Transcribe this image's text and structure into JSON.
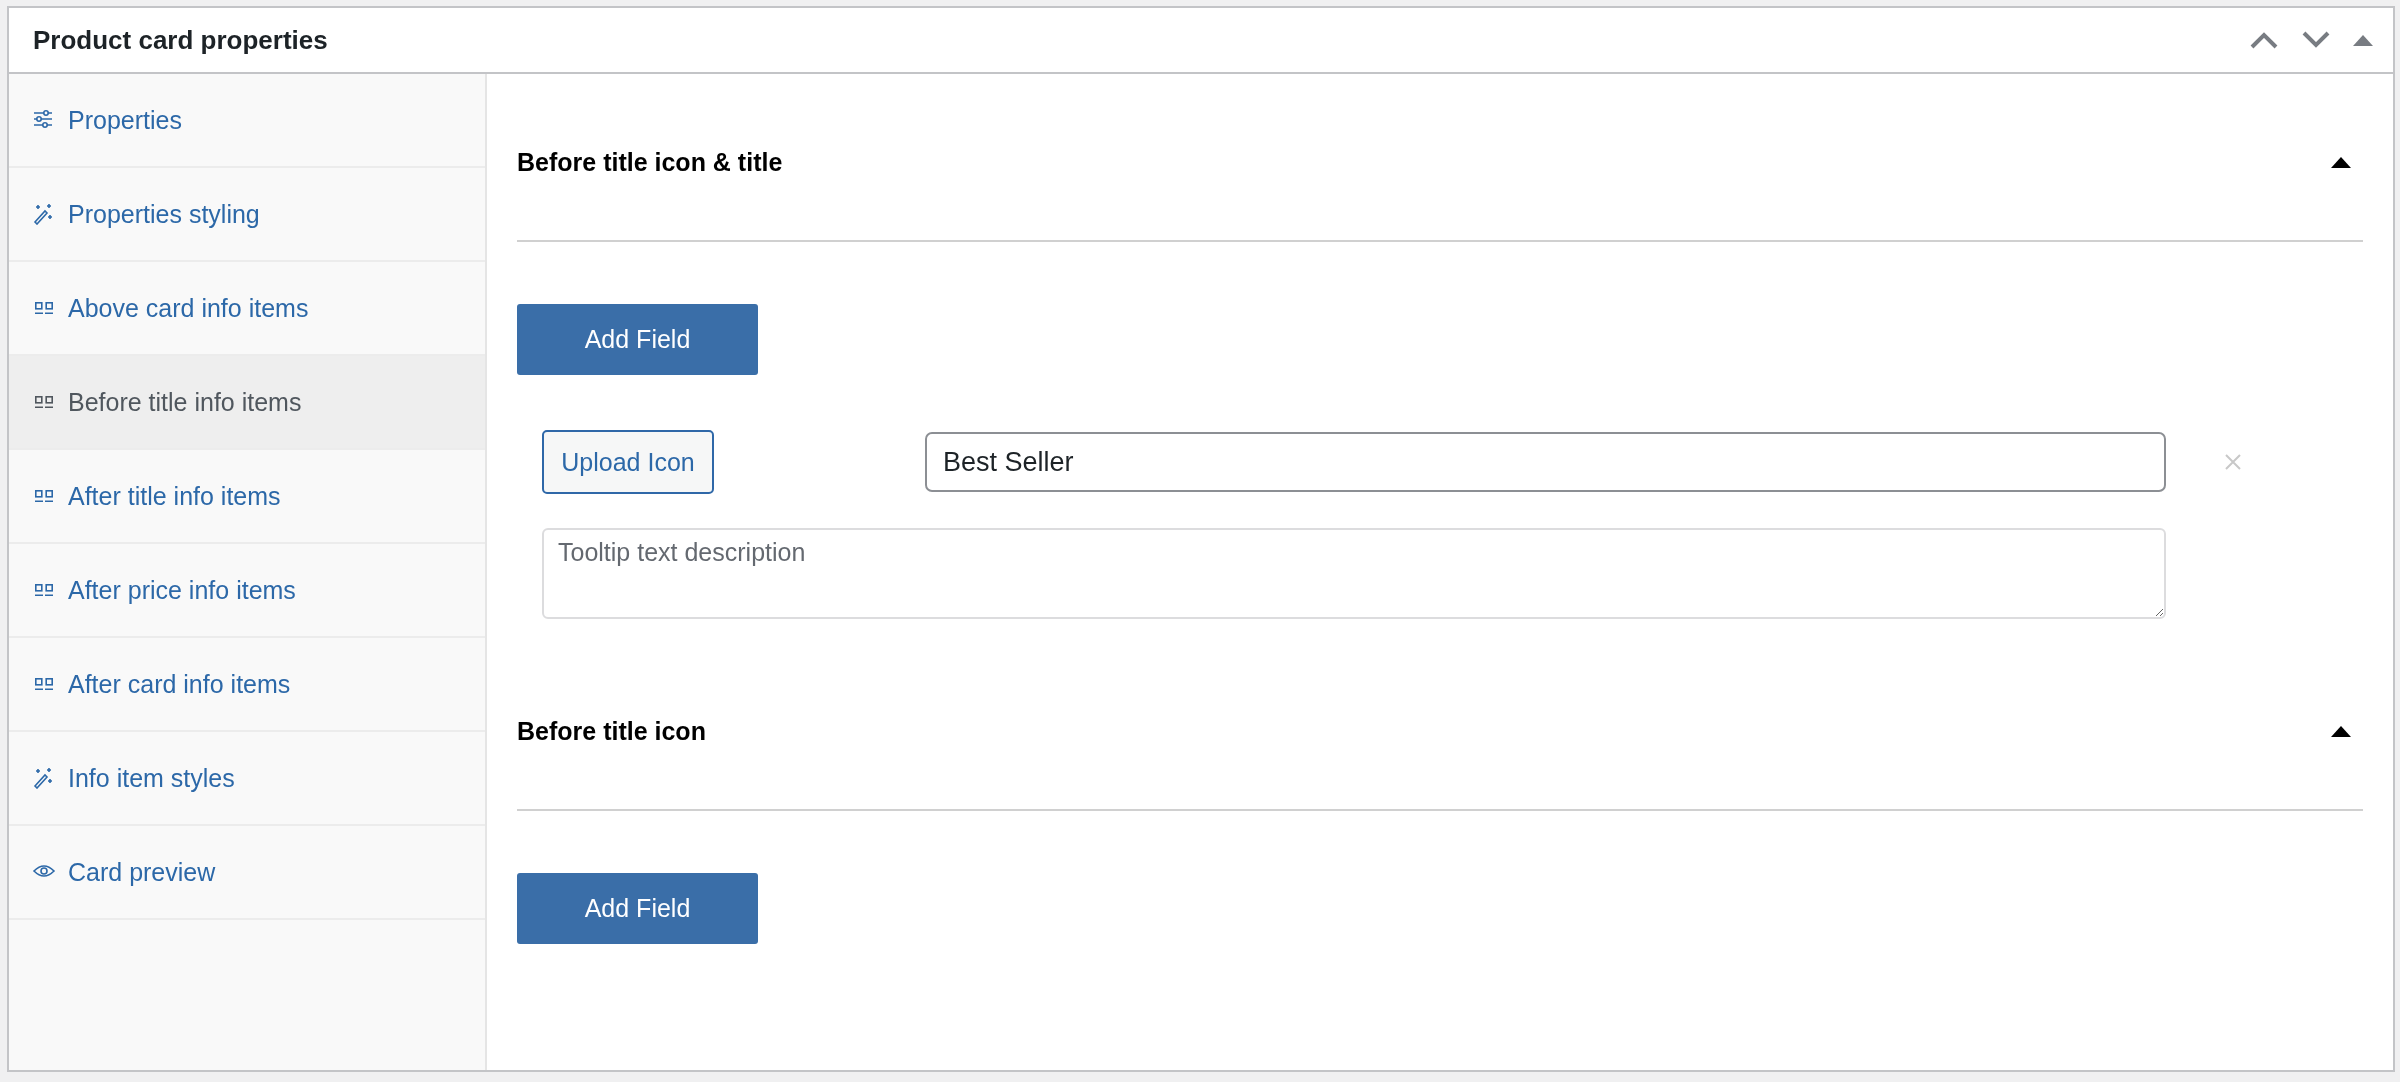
{
  "panel": {
    "title": "Product card properties",
    "expanded": true
  },
  "sidebar": {
    "items": [
      {
        "label": "Properties",
        "kind": "settings",
        "selected": false
      },
      {
        "label": "Properties styling",
        "kind": "styling",
        "selected": false
      },
      {
        "label": "Above card info items",
        "kind": "items",
        "selected": false
      },
      {
        "label": "Before title info items",
        "kind": "items",
        "selected": true
      },
      {
        "label": "After title info items",
        "kind": "items",
        "selected": false
      },
      {
        "label": "After price info items",
        "kind": "items",
        "selected": false
      },
      {
        "label": "After card info items",
        "kind": "items",
        "selected": false
      },
      {
        "label": "Info item styles",
        "kind": "styling",
        "selected": false
      },
      {
        "label": "Card preview",
        "kind": "preview",
        "selected": false
      }
    ]
  },
  "sections": [
    {
      "title": "Before title icon & title",
      "expanded": true,
      "button": "Add Field",
      "fields": [
        {
          "upload": "Upload Icon",
          "value": "Best Seller",
          "tooltip_placeholder": "Tooltip text description"
        }
      ]
    },
    {
      "title": "Before title icon",
      "expanded": true,
      "button": "Add Field"
    }
  ]
}
